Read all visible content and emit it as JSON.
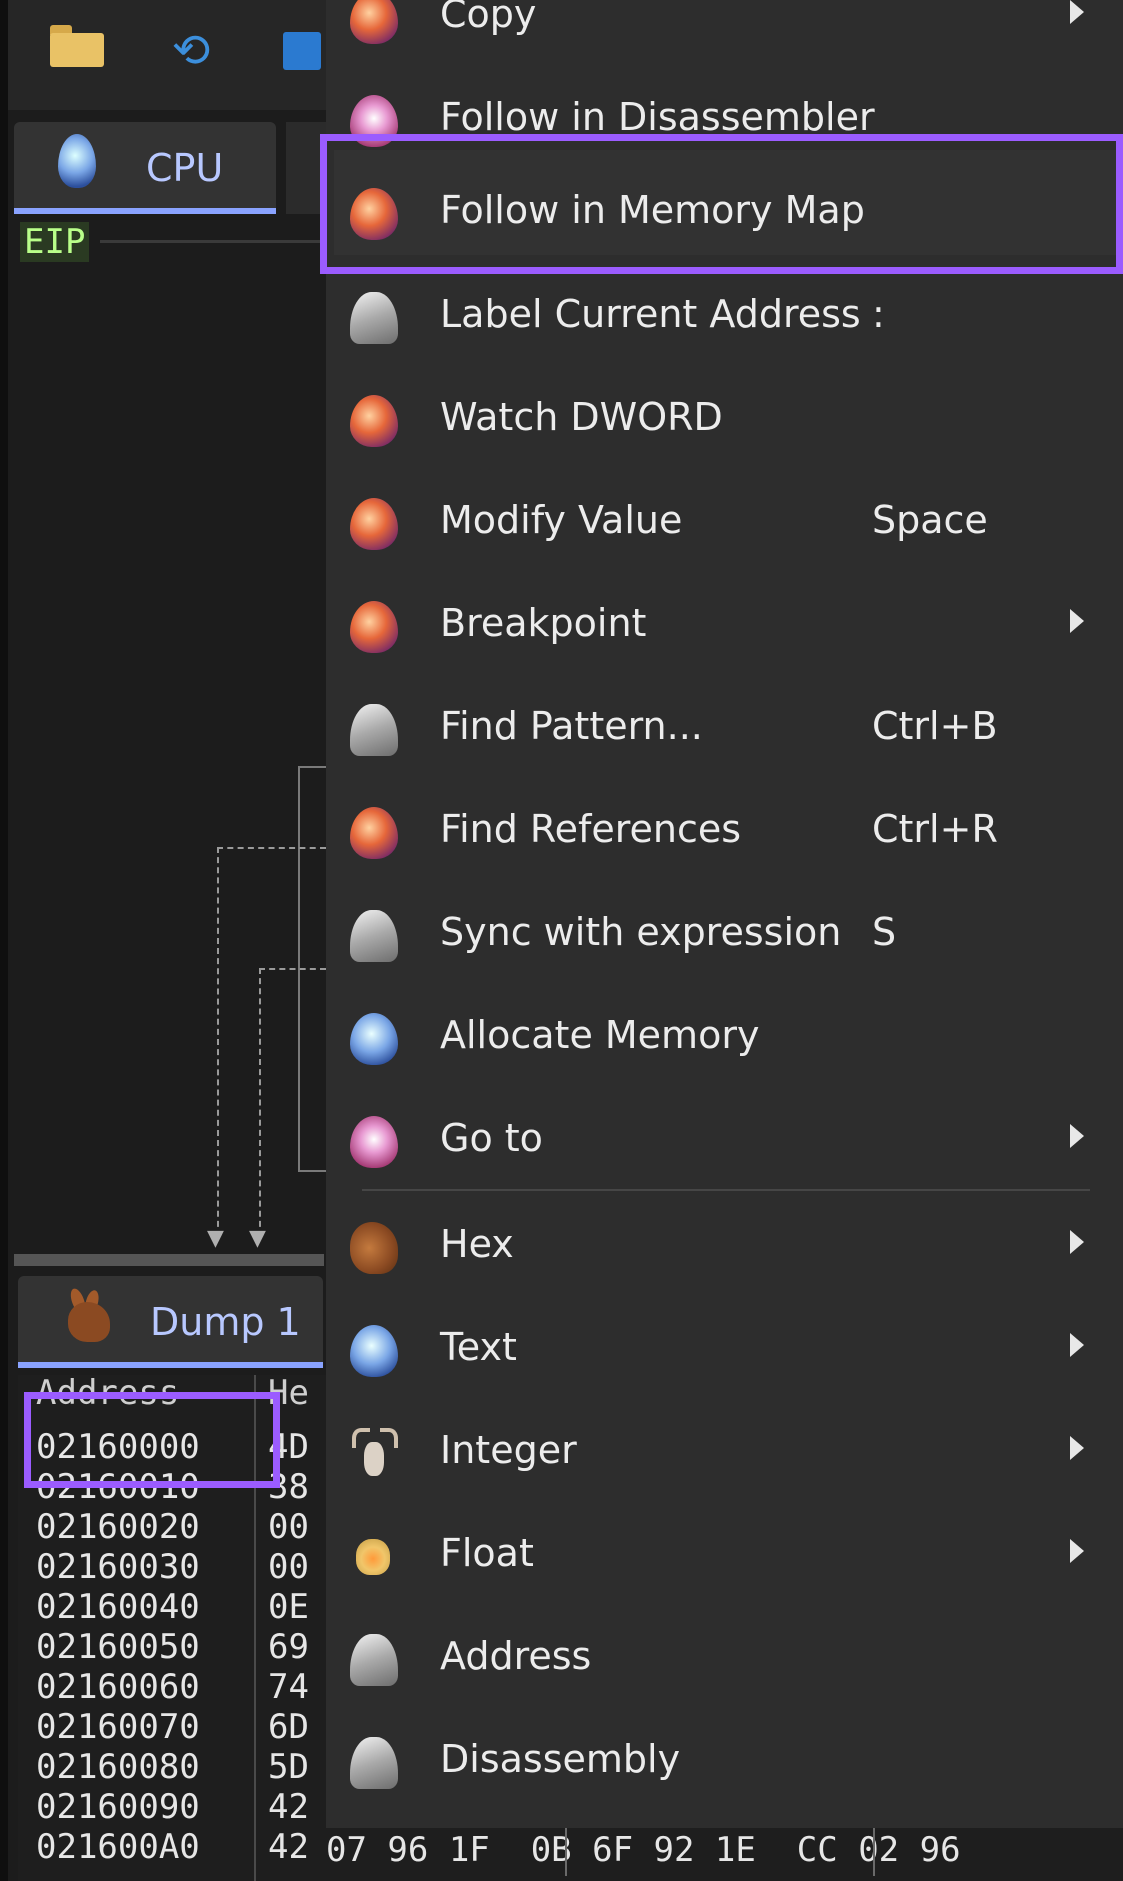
{
  "cpu_tab": {
    "label": "CPU"
  },
  "eip_label": "EIP",
  "dump_tab": {
    "label": "Dump 1"
  },
  "dump": {
    "headers": {
      "address": "Address",
      "hex": "He"
    },
    "rows": [
      {
        "address": "02160000",
        "hex": "4D"
      },
      {
        "address": "02160010",
        "hex": "38"
      },
      {
        "address": "02160020",
        "hex": "00"
      },
      {
        "address": "02160030",
        "hex": "00"
      },
      {
        "address": "02160040",
        "hex": "0E"
      },
      {
        "address": "02160050",
        "hex": "69"
      },
      {
        "address": "02160060",
        "hex": "74"
      },
      {
        "address": "02160070",
        "hex": "6D"
      },
      {
        "address": "02160080",
        "hex": "5D"
      },
      {
        "address": "02160090",
        "hex": "42"
      },
      {
        "address": "021600A0",
        "hex": "42"
      }
    ],
    "bottom_row_rest": "07 96 1F  0B 6F 92 1E  CC 02 96"
  },
  "context_menu": {
    "items": [
      {
        "label": "Copy",
        "shortcut": "",
        "submenu": true,
        "icon": "red-egg-icon"
      },
      {
        "label": "Follow in Disassembler",
        "shortcut": "",
        "submenu": false,
        "icon": "pink-egg-icon"
      },
      {
        "label": "Follow in Memory Map",
        "shortcut": "",
        "submenu": false,
        "icon": "red-egg-icon",
        "highlighted": true
      },
      {
        "label": "Label Current Address",
        "shortcut": ":",
        "submenu": false,
        "icon": "bell-icon"
      },
      {
        "label": "Watch DWORD",
        "shortcut": "",
        "submenu": false,
        "icon": "red-egg-icon"
      },
      {
        "label": "Modify Value",
        "shortcut": "Space",
        "submenu": false,
        "icon": "red-egg-icon"
      },
      {
        "label": "Breakpoint",
        "shortcut": "",
        "submenu": true,
        "icon": "red-egg-icon"
      },
      {
        "label": "Find Pattern...",
        "shortcut": "Ctrl+B",
        "submenu": false,
        "icon": "bell-icon"
      },
      {
        "label": "Find References",
        "shortcut": "Ctrl+R",
        "submenu": false,
        "icon": "red-egg-icon"
      },
      {
        "label": "Sync with expression",
        "shortcut": "S",
        "submenu": false,
        "icon": "bell-icon"
      },
      {
        "label": "Allocate Memory",
        "shortcut": "",
        "submenu": false,
        "icon": "blue-egg-icon"
      },
      {
        "label": "Go to",
        "shortcut": "",
        "submenu": true,
        "icon": "pink-egg-icon"
      },
      {
        "label": "Hex",
        "shortcut": "",
        "submenu": true,
        "icon": "bunny-icon"
      },
      {
        "label": "Text",
        "shortcut": "",
        "submenu": true,
        "icon": "blue-egg-icon"
      },
      {
        "label": "Integer",
        "shortcut": "",
        "submenu": true,
        "icon": "goat-icon"
      },
      {
        "label": "Float",
        "shortcut": "",
        "submenu": true,
        "icon": "yellow-egg-icon"
      },
      {
        "label": "Address",
        "shortcut": "",
        "submenu": false,
        "icon": "bell-icon"
      },
      {
        "label": "Disassembly",
        "shortcut": "",
        "submenu": false,
        "icon": "bell-icon"
      }
    ]
  },
  "colors": {
    "highlight": "#9b5cff",
    "tab_underline": "#8aa3ff",
    "menu_bg": "#2d2d2d",
    "eip_text": "#b9ff8a"
  }
}
